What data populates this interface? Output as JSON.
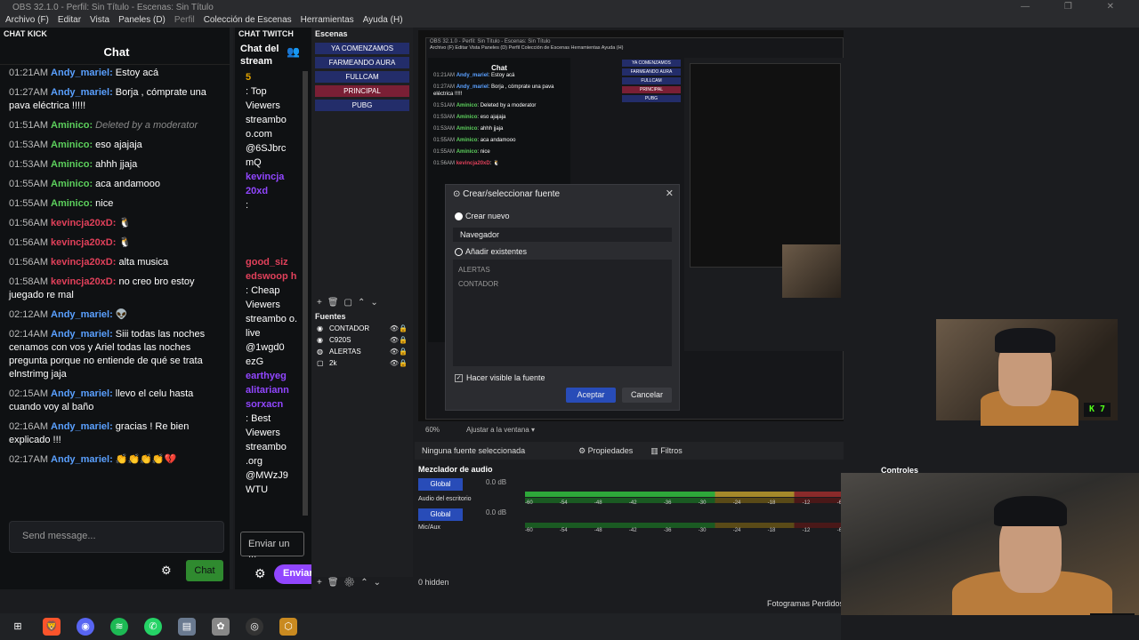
{
  "window": {
    "title": "OBS 32.1.0 - Perfil: Sin Título - Escenas: Sin Título",
    "menu": [
      "Archivo (F)",
      "Editar",
      "Vista",
      "Paneles (D)",
      "Perfil",
      "Colección de Escenas",
      "Herramientas",
      "Ayuda (H)"
    ]
  },
  "kick": {
    "dock_title": "CHAT KICK",
    "header": "Chat",
    "messages": [
      {
        "time": "01:21AM",
        "user": "Andy_mariel",
        "color": "blue",
        "text": "Estoy acá"
      },
      {
        "time": "01:27AM",
        "user": "Andy_mariel",
        "color": "blue",
        "text": "Borja , cómprate una pava eléctrica !!!!!"
      },
      {
        "time": "01:51AM",
        "user": "Aminico",
        "color": "green",
        "text": "Deleted by a moderator",
        "deleted": true
      },
      {
        "time": "01:53AM",
        "user": "Aminico",
        "color": "green",
        "text": "eso ajajaja"
      },
      {
        "time": "01:53AM",
        "user": "Aminico",
        "color": "green",
        "text": "ahhh jjaja"
      },
      {
        "time": "01:55AM",
        "user": "Aminico",
        "color": "green",
        "text": "aca andamooo"
      },
      {
        "time": "01:55AM",
        "user": "Aminico",
        "color": "green",
        "text": "nice"
      },
      {
        "time": "01:56AM",
        "user": "kevincja20xD",
        "color": "red",
        "text": "🐧"
      },
      {
        "time": "01:56AM",
        "user": "kevincja20xD",
        "color": "red",
        "text": "🐧"
      },
      {
        "time": "01:56AM",
        "user": "kevincja20xD",
        "color": "red",
        "text": "alta musica"
      },
      {
        "time": "01:58AM",
        "user": "kevincja20xD",
        "color": "red",
        "text": "no creo bro estoy juegado re mal"
      },
      {
        "time": "02:12AM",
        "user": "Andy_mariel",
        "color": "blue",
        "text": "👽"
      },
      {
        "time": "02:14AM",
        "user": "Andy_mariel",
        "color": "blue",
        "text": "Siii todas las noches cenamos con vos y Ariel todas las noches pregunta porque no entiende de qué se trata elnstrimg jaja"
      },
      {
        "time": "02:15AM",
        "user": "Andy_mariel",
        "color": "blue",
        "text": "llevo el celu hasta cuando voy al baño"
      },
      {
        "time": "02:16AM",
        "user": "Andy_mariel",
        "color": "blue",
        "text": "gracias ! Re bien explicado !!!"
      },
      {
        "time": "02:17AM",
        "user": "Andy_mariel",
        "color": "blue",
        "text": "👏👏👏👏💔"
      }
    ],
    "send_placeholder": "Send message...",
    "chat_button": "Chat"
  },
  "twitch": {
    "dock_title": "CHAT TWITCH",
    "header": "Chat del stream",
    "lines": [
      {
        "kind": "gold",
        "text": "5"
      },
      {
        "kind": "text",
        "text": ": Top Viewers streambo o.com @6SJbrc mQ"
      },
      {
        "kind": "user",
        "text": "kevincja 20xd"
      },
      {
        "kind": "text",
        "text": ":"
      },
      {
        "kind": "user2",
        "text": "good_siz edswoop h"
      },
      {
        "kind": "text",
        "text": ": Cheap Viewers streambo o. live @1wgd0 ezG"
      },
      {
        "kind": "user",
        "text": "earthyeg alitariann sorxacn"
      },
      {
        "kind": "text",
        "text": ": Best Viewers streambo .org @MWzJ9 WTU"
      }
    ],
    "input_placeholder": "Enviar un ...",
    "send_button": "Enviar"
  },
  "scenes": {
    "title": "Escenas",
    "items": [
      {
        "label": "YA COMENZAMOS",
        "active": false
      },
      {
        "label": "FARMEANDO AURA",
        "active": false
      },
      {
        "label": "FULLCAM",
        "active": false
      },
      {
        "label": "PRINCIPAL",
        "active": true
      },
      {
        "label": "PUBG",
        "active": false
      }
    ]
  },
  "sources": {
    "title": "Fuentes",
    "items": [
      {
        "label": "CONTADOR",
        "icon": "camera-icon"
      },
      {
        "label": "C920S",
        "icon": "camera-icon"
      },
      {
        "label": "ALERTAS",
        "icon": "browser-icon"
      },
      {
        "label": "2k",
        "icon": "window-icon"
      }
    ]
  },
  "dialog": {
    "title": "Crear/seleccionar fuente",
    "create_new": "Crear nuevo",
    "name_value": "Navegador",
    "add_existing": "Añadir existentes",
    "existing": [
      "ALERTAS",
      "CONTADOR"
    ],
    "visible_label": "Hacer visible la fuente",
    "accept": "Aceptar",
    "cancel": "Cancelar"
  },
  "controls": {
    "zoom": "60%",
    "fit": "Ajustar a la ventana",
    "no_source": "Ninguna fuente seleccionada",
    "properties": "Propiedades",
    "filters": "Filtros",
    "mixer_title": "Mezclador de audio",
    "global": "Global",
    "desktop_audio": "Audio del escritorio",
    "mic": "Mic/Aux",
    "db": "0.0 dB",
    "scale": [
      "-60",
      "-54",
      "-48",
      "-42",
      "-36",
      "-30",
      "-24",
      "-18",
      "-12",
      "-6"
    ],
    "hidden": "0 hidden",
    "controles": "Controles",
    "fotogramas": "Fotogramas Perdidos"
  },
  "badge": "K 7",
  "colors": {
    "kick_green": "#53fc18",
    "twitch_purple": "#9146ff",
    "scene_blue": "#232d6a",
    "scene_active": "#7a1f35"
  }
}
